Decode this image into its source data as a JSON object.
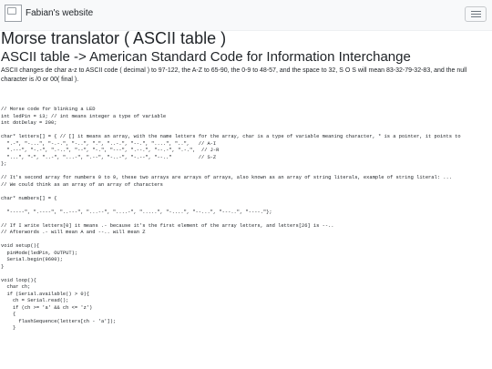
{
  "navbar": {
    "brand": "Fabian's website"
  },
  "page": {
    "title": "Morse translator ( ASCII table )",
    "subtitle": "ASCII table -> American Standard Code for Information Interchange",
    "description": "ASCII changes de char a-z to ASCII code ( decimal ) to 97-122, the A-Z to 65-90, the 0-9 to 48-57, and the space to 32, S O S will mean 83-32-79-32-83, and the null character is /0 or 00( final )."
  },
  "code": {
    "lines": [
      "// Morse code for blinking a LED",
      "int ledPin = 13; // int means integer a type of variable",
      "int dotDelay = 200;",
      "",
      "char* letters[] = { // [] it means an array, with the name letters for the array, char is a type of variable meaning character, * is a pointer, it points to",
      "  \".-\", \"-...\", \"-.-.\", \"-..\", \".\", \"..-.\", \"--.\", \"....\", \"..\",   // A-I",
      "  \".---\", \"-.-\", \".-..\", \"--\", \"-.\", \"---\", \".--.\", \"--.-\", \".-.\",  // J-R",
      "  \"...\", \"-\", \"..-\", \"...-\", \".--\", \"-..-\", \"-.--\", \"--..\"         // S-Z",
      "};",
      "",
      "// It's second array for numbers 0 to 9, these two arrays are arrays of arrays, also known as an array of string literals, example of string literal: ...",
      "// We could think as an array of an array of characters",
      "",
      "char* numbers[] = {",
      "",
      "  \"-----\", \".----\", \"..---\", \"...--\", \"....-\", \".....\", \"-....\", \"--...\", \"---..\", \"----.\"};",
      "",
      "// If I write letters[0] it means .- because it's the first element of the array letters, and letters[26] is --..",
      "// Afterwords .- will mean A and --.. will mean Z",
      "",
      "void setup(){",
      "  pinMode(ledPin, OUTPUT);",
      "  Serial.begin(9600);",
      "}",
      "",
      "void loop(){",
      "  char ch;",
      "  if (Serial.available() > 0){",
      "    ch = Serial.read();",
      "    if (ch >= 'a' && ch <= 'z')",
      "    {",
      "      flashSequence(letters[ch - 'a']);",
      "    }"
    ]
  }
}
